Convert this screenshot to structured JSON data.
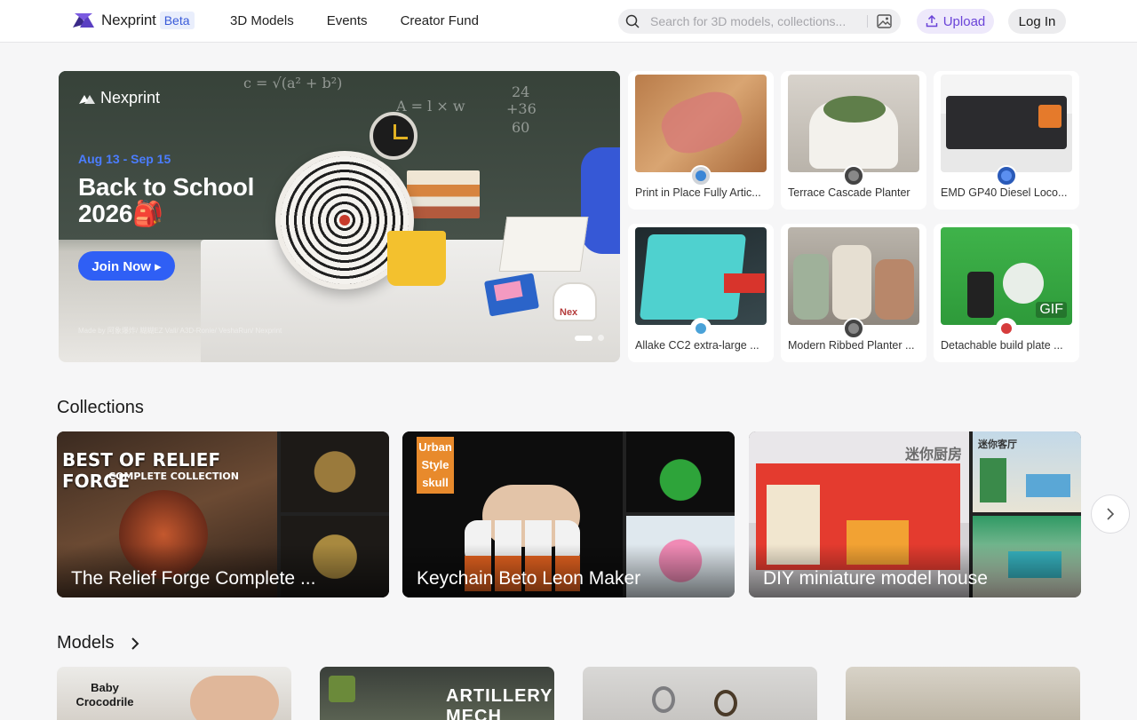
{
  "header": {
    "brand": "Nexprint",
    "beta": "Beta",
    "nav": [
      "3D Models",
      "Events",
      "Creator Fund"
    ],
    "search_placeholder": "Search for 3D models, collections...",
    "upload_label": "Upload",
    "login_label": "Log In",
    "accent_color": "#6a43d8"
  },
  "hero": {
    "brand": "Nexprint",
    "dates": "Aug 13 - Sep 15",
    "title_line1": "Back to School",
    "title_line2": "2026🎒",
    "cta": "Join Now ▸",
    "credit": "Made by 阿象爆炸/ 糊糊EZ Vali/ A3D-Ronie/ VeshaRun/ Nexprint",
    "board_ink": [
      "c = √(a² + b²)",
      "A = l × w",
      "24",
      "+36",
      "60"
    ],
    "mascot_text": "Nex",
    "slides_total": 2,
    "slide_active": 1
  },
  "grid_cards": [
    {
      "title": "Print in Place Fully Artic...",
      "badge": ""
    },
    {
      "title": "Terrace Cascade Planter",
      "badge": ""
    },
    {
      "title": "EMD GP40 Diesel Loco...",
      "badge": ""
    },
    {
      "title": "Allake CC2 extra-large ...",
      "badge": ""
    },
    {
      "title": "Modern Ribbed Planter ...",
      "badge": ""
    },
    {
      "title": "Detachable build plate ...",
      "badge": "GIF"
    }
  ],
  "collections": {
    "title": "Collections",
    "items": [
      {
        "title": "The Relief Forge Complete ...",
        "art_text": "BEST OF RELIEF FORGE",
        "art_sub": "COMPLETE COLLECTION"
      },
      {
        "title": "Keychain Beto Leon Maker",
        "art_text": "Urban Style skull",
        "art_sub": ""
      },
      {
        "title": "DIY miniature model house",
        "art_text": "迷你厨房",
        "art_sub": "迷你客厅"
      }
    ]
  },
  "models": {
    "title": "Models",
    "cards": [
      {
        "art_text": "Baby Crocodrile"
      },
      {
        "art_text": "ARTILLERY MECH"
      },
      {
        "art_text": ""
      },
      {
        "art_text": ""
      }
    ]
  }
}
